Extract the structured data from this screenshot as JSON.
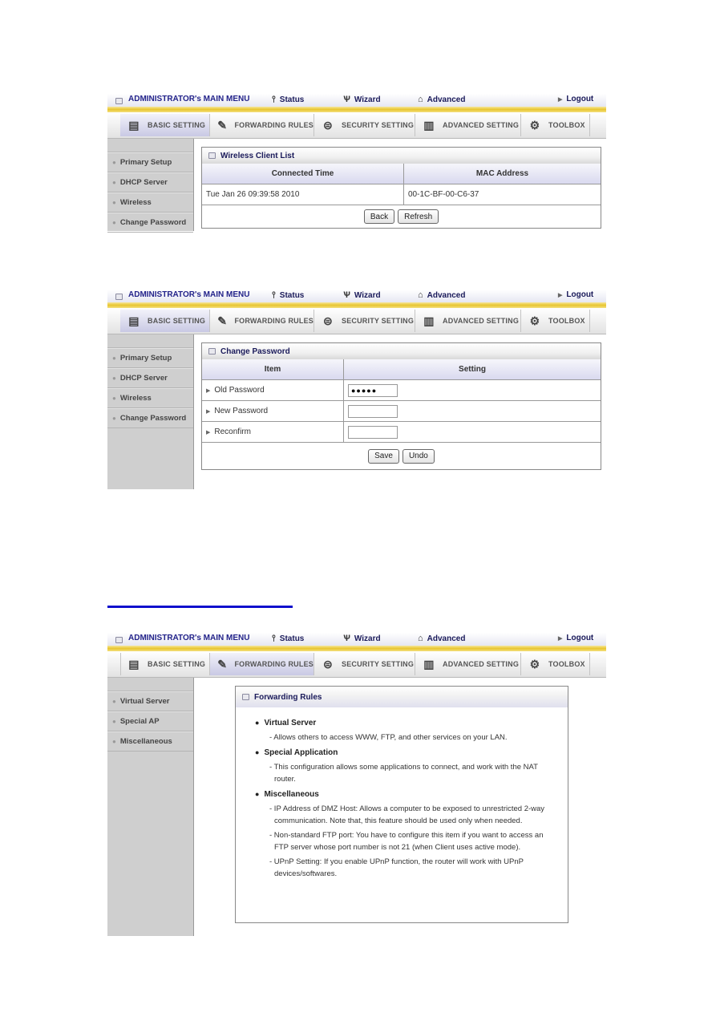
{
  "nav": {
    "menu_title": "ADMINISTRATOR's MAIN MENU",
    "status": "Status",
    "wizard": "Wizard",
    "advanced": "Advanced",
    "logout": "Logout",
    "tabs": [
      {
        "label": "BASIC SETTING",
        "icon": "basic-setting-icon"
      },
      {
        "label": "FORWARDING RULES",
        "icon": "forwarding-rules-icon"
      },
      {
        "label": "SECURITY SETTING",
        "icon": "security-setting-icon"
      },
      {
        "label": "ADVANCED SETTING",
        "icon": "advanced-setting-icon"
      },
      {
        "label": "TOOLBOX",
        "icon": "toolbox-icon"
      }
    ]
  },
  "basic_sidebar": [
    "Primary Setup",
    "DHCP Server",
    "Wireless",
    "Change Password"
  ],
  "forwarding_sidebar": [
    "Virtual Server",
    "Special AP",
    "Miscellaneous"
  ],
  "wireless_client_list": {
    "title": "Wireless Client List",
    "columns": [
      "Connected Time",
      "MAC Address"
    ],
    "rows": [
      [
        "Tue Jan 26 09:39:58 2010",
        "00-1C-BF-00-C6-37"
      ]
    ],
    "back_label": "Back",
    "refresh_label": "Refresh"
  },
  "change_password": {
    "title": "Change Password",
    "columns": [
      "Item",
      "Setting"
    ],
    "rows": [
      {
        "label": "Old Password",
        "value": "●●●●●"
      },
      {
        "label": "New Password",
        "value": ""
      },
      {
        "label": "Reconfirm",
        "value": ""
      }
    ],
    "save_label": "Save",
    "undo_label": "Undo"
  },
  "forwarding_rules": {
    "title": "Forwarding Rules",
    "sections": [
      {
        "heading": "Virtual Server",
        "items": [
          "- Allows others to access WWW, FTP, and other services on your LAN."
        ]
      },
      {
        "heading": "Special Application",
        "items": [
          "- This configuration allows some applications to connect, and work with the NAT router."
        ]
      },
      {
        "heading": "Miscellaneous",
        "items": [
          "- IP Address of DMZ Host: Allows a computer to be exposed to unrestricted 2-way communication. Note that, this feature should be used only when needed.",
          "- Non-standard FTP port: You have to configure this item if you want to access an FTP server whose port number is not 21 (when Client uses active mode).",
          "- UPnP Setting: If you enable UPnP function, the router will work with UPnP devices/softwares."
        ]
      }
    ]
  }
}
